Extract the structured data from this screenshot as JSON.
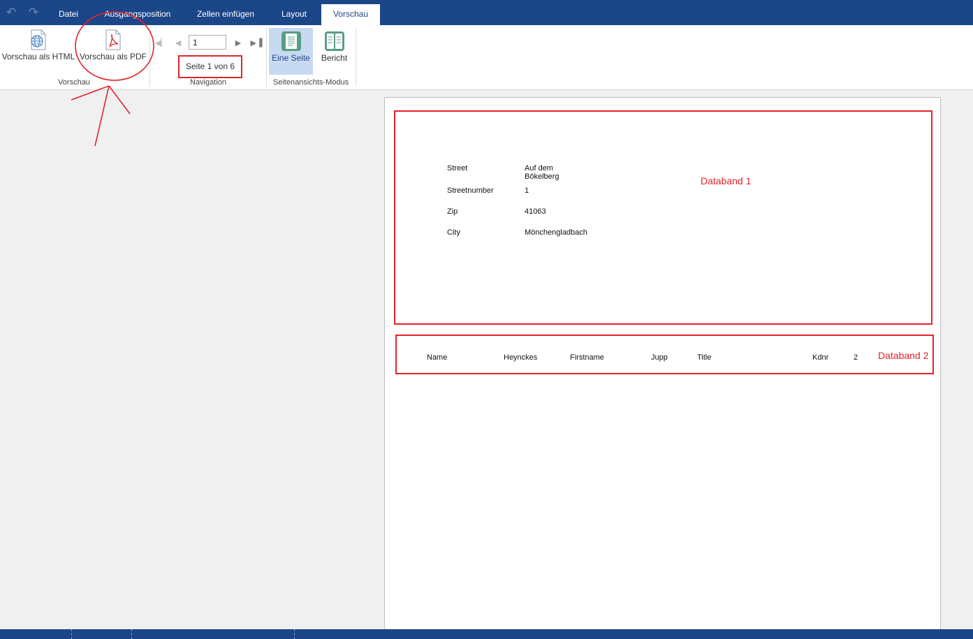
{
  "quick_access": {
    "undo_icon": "undo-icon",
    "redo_icon": "redo-icon"
  },
  "tabs": {
    "datei": "Datei",
    "ausgangsposition": "Ausgangsposition",
    "zellen_einfuegen": "Zellen einfügen",
    "layout": "Layout",
    "vorschau": "Vorschau"
  },
  "ribbon": {
    "vorschau_group": {
      "label": "Vorschau",
      "html_button": "Vorschau als HTML",
      "pdf_button": "Vorschau als PDF"
    },
    "navigation_group": {
      "label": "Navigation",
      "page_input": "1",
      "page_status": "Seite 1 von 6"
    },
    "mode_group": {
      "label": "Seitenansichts-Modus",
      "one_page_button": "Eine Seite",
      "report_button": "Bericht"
    }
  },
  "report": {
    "databand1": {
      "annotation": "Databand 1",
      "rows": [
        {
          "label": "Street",
          "value": "Auf dem\nBökelberg"
        },
        {
          "label": "Streetnumber",
          "value": "1"
        },
        {
          "label": "Zip",
          "value": "41063"
        },
        {
          "label": "City",
          "value": "Mönchengladbach"
        }
      ]
    },
    "databand2": {
      "annotation": "Databand 2",
      "name_label": "Name",
      "name_value": "Heynckes",
      "firstname_label": "Firstname",
      "firstname_value": "Jupp",
      "title_label": "Title",
      "kdnr_label": "Kdnr",
      "kdnr_value": "2"
    }
  },
  "colors": {
    "accent": "#1b4688",
    "annotation_red": "#e3222a",
    "mode_active_bg": "#c8daf2"
  }
}
